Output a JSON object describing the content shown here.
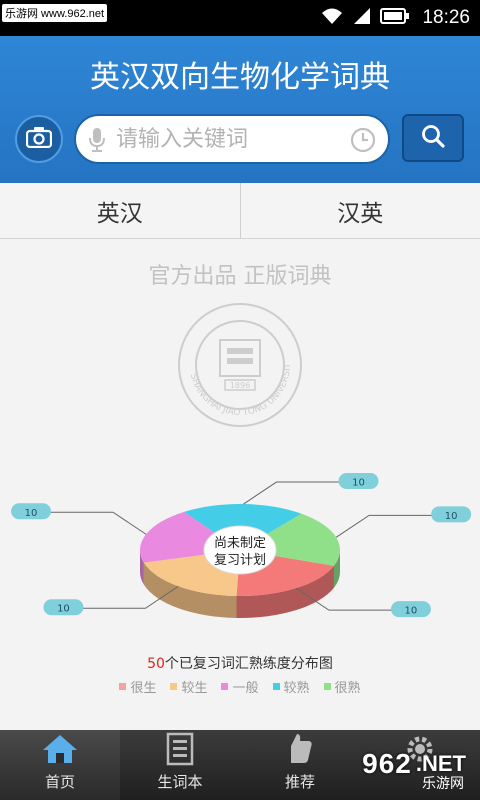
{
  "statusbar": {
    "watermark": "乐游网 www.962.net",
    "time": "18:26"
  },
  "header": {
    "title": "英汉双向生物化学词典"
  },
  "search": {
    "placeholder": "请输入关键词",
    "value": ""
  },
  "tabs": [
    {
      "label": "英汉"
    },
    {
      "label": "汉英"
    }
  ],
  "content": {
    "slogan": "官方出品 正版词典",
    "emblem_text": "SHANGHAI JIAO TONG UNIVERSITY",
    "emblem_year": "1896"
  },
  "chart_data": {
    "type": "pie",
    "center_label_line1": "尚未制定",
    "center_label_line2": "复习计划",
    "categories": [
      "很生",
      "较生",
      "一般",
      "较熟",
      "很熟"
    ],
    "values": [
      10,
      10,
      10,
      10,
      10
    ],
    "colors": [
      "#f47a7a",
      "#f8c78a",
      "#e98ae0",
      "#44cde6",
      "#90e08a"
    ],
    "labels": [
      "10",
      "10",
      "10",
      "10",
      "10"
    ]
  },
  "legend": {
    "count": "50",
    "title_suffix": "个已复习词汇熟练度分布图",
    "items": [
      {
        "label": "很生",
        "color": "#f4a3a3"
      },
      {
        "label": "较生",
        "color": "#f8c78a"
      },
      {
        "label": "一般",
        "color": "#e98ae0"
      },
      {
        "label": "较熟",
        "color": "#44cde6"
      },
      {
        "label": "很熟",
        "color": "#90e08a"
      }
    ]
  },
  "nav": [
    {
      "label": "首页",
      "icon": "home-icon"
    },
    {
      "label": "生词本",
      "icon": "notebook-icon"
    },
    {
      "label": "推荐",
      "icon": "thumbs-up-icon"
    },
    {
      "label": "设置",
      "icon": "gear-icon"
    }
  ],
  "brand": {
    "num": "962",
    "net": ".NET",
    "sub": "乐游网"
  }
}
